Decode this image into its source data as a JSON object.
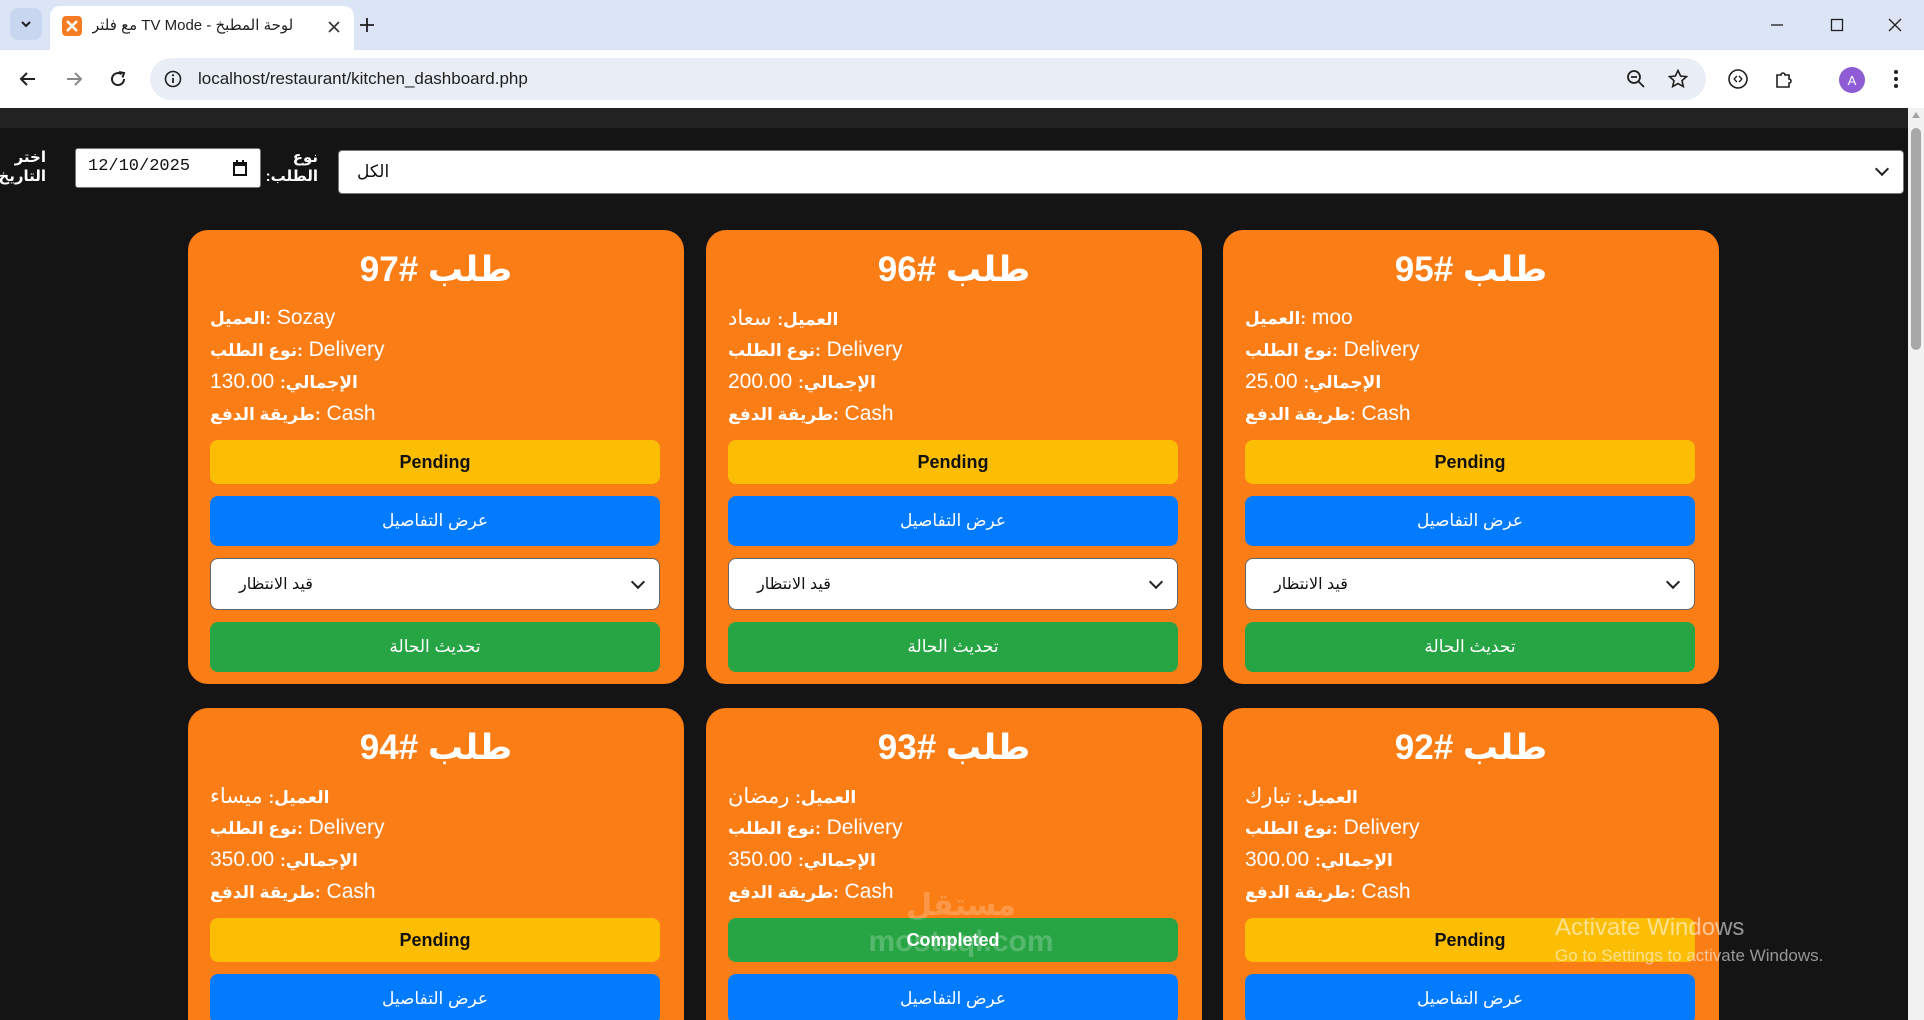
{
  "browser": {
    "tab_title": "لوحة المطبخ - TV Mode مع فلتر",
    "url": "localhost/restaurant/kitchen_dashboard.php",
    "profile_initial": "A"
  },
  "filters": {
    "date_label": "اختر التاريخ:",
    "date_value": "12/10/2025",
    "type_label": "نوع الطلب:",
    "type_value": "الكل"
  },
  "labels": {
    "customer": "العميل:",
    "order_type": "نوع الطلب:",
    "total": "الإجمالي:",
    "payment": "طريقة الدفع:",
    "details_button": "عرض التفاصيل",
    "update_button": "تحديث الحالة",
    "status_select": "قيد الانتظار"
  },
  "orders": [
    {
      "title": "طلب #97",
      "customer": "Sozay",
      "type": "Delivery",
      "total": "130.00",
      "payment": "Cash",
      "status": "Pending"
    },
    {
      "title": "طلب #96",
      "customer": "سعاد",
      "type": "Delivery",
      "total": "200.00",
      "payment": "Cash",
      "status": "Pending"
    },
    {
      "title": "طلب #95",
      "customer": "moo",
      "type": "Delivery",
      "total": "25.00",
      "payment": "Cash",
      "status": "Pending"
    },
    {
      "title": "طلب #94",
      "customer": "ميساء",
      "type": "Delivery",
      "total": "350.00",
      "payment": "Cash",
      "status": "Pending"
    },
    {
      "title": "طلب #93",
      "customer": "رمضان",
      "type": "Delivery",
      "total": "350.00",
      "payment": "Cash",
      "status": "Completed"
    },
    {
      "title": "طلب #92",
      "customer": "تبارك",
      "type": "Delivery",
      "total": "300.00",
      "payment": "Cash",
      "status": "Pending"
    }
  ],
  "overlay": {
    "watermark_ar": "مستقل",
    "watermark_en": "mostaql.com",
    "activate_title": "Activate Windows",
    "activate_sub": "Go to Settings to activate Windows."
  }
}
